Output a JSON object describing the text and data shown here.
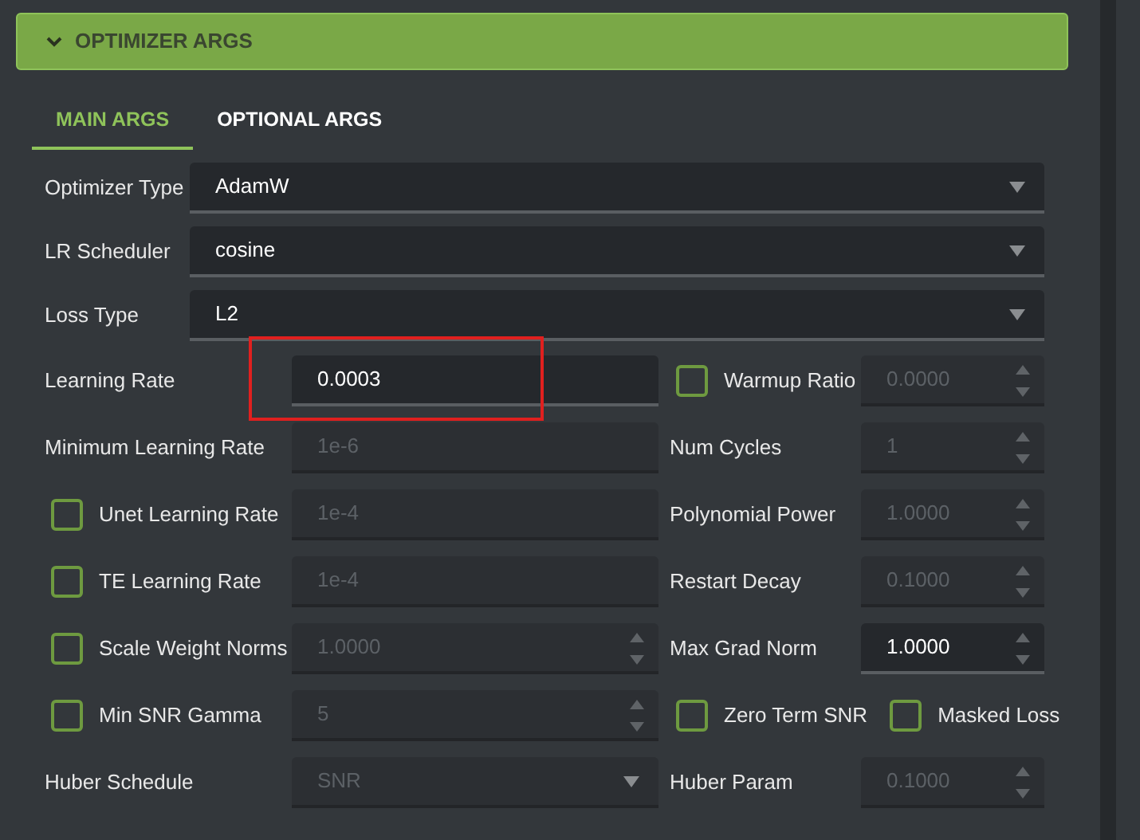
{
  "section": {
    "title": "OPTIMIZER ARGS",
    "expanded": true
  },
  "tabs": [
    {
      "label": "MAIN ARGS",
      "selected": true
    },
    {
      "label": "OPTIONAL ARGS",
      "selected": false
    }
  ],
  "selects": [
    {
      "label": "Optimizer Type",
      "value": "AdamW"
    },
    {
      "label": "LR Scheduler",
      "value": "cosine"
    },
    {
      "label": "Loss Type",
      "value": "L2"
    }
  ],
  "rows": [
    {
      "left": {
        "kind": "field",
        "label": "Learning Rate",
        "field": {
          "kind": "text",
          "value": "0.0003",
          "disabled": false,
          "highlighted": true
        }
      },
      "right": {
        "kind": "field",
        "label": "Warmup Ratio",
        "checked": false,
        "field": {
          "kind": "spin",
          "value": "0.0000",
          "disabled": true,
          "highlighted": false
        }
      }
    },
    {
      "left": {
        "kind": "field",
        "label": "Minimum Learning Rate",
        "field": {
          "kind": "text",
          "value": "1e-6",
          "disabled": true,
          "highlighted": false
        }
      },
      "right": {
        "kind": "field",
        "label": "Num Cycles",
        "field": {
          "kind": "spin",
          "value": "1",
          "disabled": true,
          "highlighted": false
        }
      }
    },
    {
      "left": {
        "kind": "field",
        "label": "Unet Learning Rate",
        "checked": false,
        "field": {
          "kind": "text",
          "value": "1e-4",
          "disabled": true,
          "highlighted": false
        }
      },
      "right": {
        "kind": "field",
        "label": "Polynomial Power",
        "field": {
          "kind": "spin",
          "value": "1.0000",
          "disabled": true,
          "highlighted": false
        }
      }
    },
    {
      "left": {
        "kind": "field",
        "label": "TE Learning Rate",
        "checked": false,
        "field": {
          "kind": "text",
          "value": "1e-4",
          "disabled": true,
          "highlighted": false
        }
      },
      "right": {
        "kind": "field",
        "label": "Restart Decay",
        "field": {
          "kind": "spin",
          "value": "0.1000",
          "disabled": true,
          "highlighted": false
        }
      }
    },
    {
      "left": {
        "kind": "field",
        "label": "Scale Weight Norms",
        "checked": false,
        "field": {
          "kind": "spin",
          "value": "1.0000",
          "disabled": true,
          "highlighted": false
        }
      },
      "right": {
        "kind": "field",
        "label": "Max Grad Norm",
        "field": {
          "kind": "spin",
          "value": "1.0000",
          "disabled": false,
          "highlighted": false
        }
      }
    },
    {
      "left": {
        "kind": "field",
        "label": "Min SNR Gamma",
        "checked": false,
        "field": {
          "kind": "spin",
          "value": "5",
          "disabled": true,
          "highlighted": false
        }
      },
      "right": {
        "kind": "checks",
        "checkboxes": [
          {
            "label": "Zero Term SNR",
            "checked": false
          },
          {
            "label": "Masked Loss",
            "checked": false
          }
        ]
      }
    },
    {
      "left": {
        "kind": "field",
        "label": "Huber Schedule",
        "field": {
          "kind": "select",
          "value": "SNR",
          "disabled": true,
          "highlighted": false
        }
      },
      "right": {
        "kind": "field",
        "label": "Huber Param",
        "field": {
          "kind": "spin",
          "value": "0.1000",
          "disabled": true,
          "highlighted": false
        }
      }
    }
  ]
}
